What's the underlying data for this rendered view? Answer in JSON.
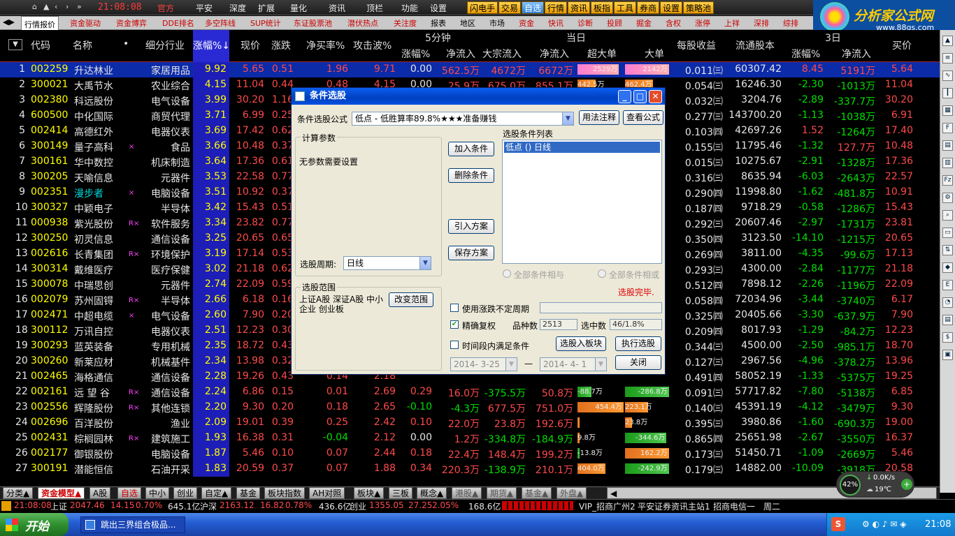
{
  "menubar": {
    "nav_icons": [
      "⌂",
      "▲",
      "‹",
      "›",
      "»"
    ],
    "time": "21:08:08",
    "items": [
      "官方",
      "平安",
      "深度",
      "扩展",
      "量化",
      "资讯",
      "顶栏",
      "功能",
      "设置"
    ],
    "toolbar_buttons": [
      "闪电手",
      "交易",
      "自选",
      "行情",
      "资讯",
      "板指",
      "工具",
      "券商",
      "设置",
      "策略池"
    ]
  },
  "logo": {
    "title": "分析家公式网",
    "url_text": "www.88gs.com"
  },
  "tabbar": {
    "tabs": [
      "行情报价",
      "资金驱动",
      "资金博弈",
      "DDE排名",
      "多空阵线",
      "SUP统计",
      "东证股票池",
      "潜伏热点",
      "关注度",
      "报表",
      "地区",
      "市场",
      "资金",
      "快讯",
      "诊断",
      "投顾",
      "掘金",
      "含权",
      "涨停",
      "上祥",
      "深排",
      "综排"
    ]
  },
  "table": {
    "headers": {
      "code": "代码",
      "name": "名称",
      "industry": "细分行业",
      "pct": "涨幅%↓",
      "price": "现价",
      "change": "涨跌",
      "net_buy_rate": "净买率%",
      "attack_wave": "攻击波%",
      "min5_group": "5分钟",
      "min5_pct": "涨幅%",
      "min5_netflow": "净流入",
      "today_group": "当日",
      "block_flow": "大宗流入",
      "today_netflow": "净流入",
      "super_large": "超大单",
      "large": "大单",
      "eps": "每股收益",
      "float_shares": "流通股本",
      "d3_group": "3日",
      "d3_pct": "涨幅%",
      "d3_netflow": "净流入",
      "bid": "买价"
    },
    "rows": [
      {
        "n": "1",
        "code": "002259",
        "name": "升达林业",
        "mark": "",
        "industry": "家居用品",
        "pct": "9.92",
        "price": "5.65",
        "chg": "0.51",
        "nb": "1.96",
        "aw": "9.71",
        "m5p": "0.00",
        "m5f": "562.5万",
        "blk": "4672万",
        "tf": "6672万",
        "sup": "2529万",
        "sup_w": 0.9,
        "lrg": "2142万",
        "lrg_w": 0.95,
        "eps": "0.011㈢",
        "fs": "60307.42",
        "d3p": "8.45",
        "d3f": "5191万",
        "bid": "5.64"
      },
      {
        "n": "2",
        "code": "300021",
        "name": "大禹节水",
        "mark": "",
        "industry": "农业综合",
        "pct": "4.15",
        "price": "11.04",
        "chg": "0.44",
        "nb": "0.48",
        "aw": "4.15",
        "m5p": "0.00",
        "m5f": "25.9万",
        "blk": "675.0万",
        "tf": "855.1万",
        "sup": "442.5万",
        "sup_w": 0.4,
        "lrg": "462.4万",
        "lrg_w": 0.6,
        "eps": "0.054㈢",
        "fs": "16246.30",
        "d3p": "-2.30",
        "d3f": "-1013万",
        "bid": "11.04"
      },
      {
        "n": "3",
        "code": "002380",
        "name": "科远股份",
        "mark": "",
        "industry": "电气设备",
        "pct": "3.99",
        "price": "30.20",
        "chg": "1.16",
        "nb": "",
        "aw": "",
        "m5p": "",
        "m5f": "",
        "blk": "",
        "tf": "",
        "sup": "",
        "sup_w": 0,
        "lrg": "",
        "lrg_w": 0.2,
        "eps": "0.032㈢",
        "fs": "3204.76",
        "d3p": "-2.89",
        "d3f": "-337.7万",
        "bid": "30.20"
      },
      {
        "n": "4",
        "code": "600500",
        "name": "中化国际",
        "mark": "",
        "industry": "商贸代理",
        "pct": "3.71",
        "price": "6.99",
        "chg": "0.25",
        "nb": "",
        "aw": "",
        "m5p": "",
        "m5f": "",
        "blk": "",
        "tf": "",
        "sup": "",
        "sup_w": 0,
        "lrg": "",
        "lrg_w": 0.1,
        "eps": "0.277㈢",
        "fs": "143700.20",
        "d3p": "-1.13",
        "d3f": "-1038万",
        "bid": "6.91"
      },
      {
        "n": "5",
        "code": "002414",
        "name": "高德红外",
        "mark": "",
        "industry": "电器仪表",
        "pct": "3.69",
        "price": "17.42",
        "chg": "0.62",
        "nb": "",
        "aw": "",
        "m5p": "",
        "m5f": "",
        "blk": "",
        "tf": "",
        "sup": "",
        "sup_w": 0,
        "lrg": "",
        "lrg_w": 0.1,
        "eps": "0.103㈣",
        "fs": "42697.26",
        "d3p": "1.52",
        "d3f": "-1264万",
        "bid": "17.40"
      },
      {
        "n": "6",
        "code": "300149",
        "name": "量子高科",
        "mark": "×",
        "industry": "食品",
        "pct": "3.66",
        "price": "10.48",
        "chg": "0.37",
        "nb": "",
        "aw": "",
        "m5p": "",
        "m5f": "",
        "blk": "",
        "tf": "",
        "sup": "",
        "sup_w": 0,
        "lrg": "",
        "lrg_w": 0.1,
        "eps": "0.155㈢",
        "fs": "11795.46",
        "d3p": "-1.32",
        "d3f": "127.7万",
        "bid": "10.48"
      },
      {
        "n": "7",
        "code": "300161",
        "name": "华中数控",
        "mark": "",
        "industry": "机床制造",
        "pct": "3.64",
        "price": "17.36",
        "chg": "0.61",
        "nb": "",
        "aw": "",
        "m5p": "",
        "m5f": "",
        "blk": "",
        "tf": "",
        "sup": "",
        "sup_w": 0,
        "lrg": "",
        "lrg_w": 0.1,
        "eps": "0.015㈢",
        "fs": "10275.67",
        "d3p": "-2.91",
        "d3f": "-1328万",
        "bid": "17.36"
      },
      {
        "n": "8",
        "code": "300205",
        "name": "天喻信息",
        "mark": "",
        "industry": "元器件",
        "pct": "3.53",
        "price": "22.58",
        "chg": "0.77",
        "nb": "",
        "aw": "",
        "m5p": "",
        "m5f": "",
        "blk": "",
        "tf": "",
        "sup": "",
        "sup_w": 0,
        "lrg": "",
        "lrg_w": 0.1,
        "eps": "0.316㈢",
        "fs": "8635.94",
        "d3p": "-6.03",
        "d3f": "-2643万",
        "bid": "22.57"
      },
      {
        "n": "9",
        "code": "002351",
        "name": "漫步者",
        "mark": "×",
        "industry": "电脑设备",
        "pct": "3.51",
        "price": "10.92",
        "chg": "0.37",
        "nb": "",
        "aw": "",
        "m5p": "",
        "m5f": "",
        "blk": "",
        "tf": "",
        "sup": "",
        "sup_w": 0,
        "lrg": "",
        "lrg_w": 0.1,
        "eps": "0.290㈣",
        "fs": "11998.80",
        "d3p": "-1.62",
        "d3f": "-481.8万",
        "bid": "10.91"
      },
      {
        "n": "10",
        "code": "300327",
        "name": "中颖电子",
        "mark": "",
        "industry": "半导体",
        "pct": "3.42",
        "price": "15.43",
        "chg": "0.51",
        "nb": "",
        "aw": "",
        "m5p": "",
        "m5f": "",
        "blk": "",
        "tf": "",
        "sup": "",
        "sup_w": 0,
        "lrg": "",
        "lrg_w": 0.1,
        "eps": "0.187㈣",
        "fs": "9718.29",
        "d3p": "-0.58",
        "d3f": "-1286万",
        "bid": "15.43"
      },
      {
        "n": "11",
        "code": "000938",
        "name": "紫光股份",
        "mark": "R×",
        "industry": "软件服务",
        "pct": "3.34",
        "price": "23.82",
        "chg": "0.77",
        "nb": "",
        "aw": "",
        "m5p": "",
        "m5f": "",
        "blk": "",
        "tf": "",
        "sup": "",
        "sup_w": 0,
        "lrg": "",
        "lrg_w": 0.1,
        "eps": "0.292㈢",
        "fs": "20607.46",
        "d3p": "-2.97",
        "d3f": "-1731万",
        "bid": "23.81"
      },
      {
        "n": "12",
        "code": "300250",
        "name": "初灵信息",
        "mark": "",
        "industry": "通信设备",
        "pct": "3.25",
        "price": "20.65",
        "chg": "0.65",
        "nb": "",
        "aw": "",
        "m5p": "",
        "m5f": "",
        "blk": "",
        "tf": "",
        "sup": "",
        "sup_w": 0,
        "lrg": "",
        "lrg_w": 0.1,
        "eps": "0.350㈣",
        "fs": "3123.50",
        "d3p": "-14.10",
        "d3f": "-1215万",
        "bid": "20.65"
      },
      {
        "n": "13",
        "code": "002616",
        "name": "长青集团",
        "mark": "R×",
        "industry": "环境保护",
        "pct": "3.19",
        "price": "17.14",
        "chg": "0.53",
        "nb": "",
        "aw": "",
        "m5p": "",
        "m5f": "",
        "blk": "",
        "tf": "",
        "sup": "",
        "sup_w": 0,
        "lrg": "",
        "lrg_w": 0.1,
        "eps": "0.269㈣",
        "fs": "3811.00",
        "d3p": "-4.35",
        "d3f": "-99.6万",
        "bid": "17.13"
      },
      {
        "n": "14",
        "code": "300314",
        "name": "戴维医疗",
        "mark": "",
        "industry": "医疗保健",
        "pct": "3.02",
        "price": "21.18",
        "chg": "0.62",
        "nb": "",
        "aw": "",
        "m5p": "",
        "m5f": "",
        "blk": "",
        "tf": "",
        "sup": "",
        "sup_w": 0,
        "lrg": "",
        "lrg_w": 0.1,
        "eps": "0.293㈢",
        "fs": "4300.00",
        "d3p": "-2.84",
        "d3f": "-1177万",
        "bid": "21.18"
      },
      {
        "n": "15",
        "code": "300078",
        "name": "中瑞思创",
        "mark": "",
        "industry": "元器件",
        "pct": "2.74",
        "price": "22.09",
        "chg": "0.59",
        "nb": "",
        "aw": "",
        "m5p": "",
        "m5f": "",
        "blk": "",
        "tf": "",
        "sup": "",
        "sup_w": 0,
        "lrg": "",
        "lrg_w": 0.1,
        "eps": "0.512㈣",
        "fs": "7898.12",
        "d3p": "-2.26",
        "d3f": "-1196万",
        "bid": "22.09"
      },
      {
        "n": "16",
        "code": "002079",
        "name": "苏州固锝",
        "mark": "R×",
        "industry": "半导体",
        "pct": "2.66",
        "price": "6.18",
        "chg": "0.16",
        "nb": "",
        "aw": "",
        "m5p": "",
        "m5f": "",
        "blk": "",
        "tf": "",
        "sup": "",
        "sup_w": 0,
        "lrg": "",
        "lrg_w": 0.1,
        "eps": "0.058㈣",
        "fs": "72034.96",
        "d3p": "-3.44",
        "d3f": "-3740万",
        "bid": "6.17"
      },
      {
        "n": "17",
        "code": "002471",
        "name": "中超电缆",
        "mark": "×",
        "industry": "电气设备",
        "pct": "2.60",
        "price": "7.90",
        "chg": "0.20",
        "nb": "",
        "aw": "",
        "m5p": "",
        "m5f": "",
        "blk": "",
        "tf": "",
        "sup": "",
        "sup_w": 0,
        "lrg": "",
        "lrg_w": 0.1,
        "eps": "0.325㈣",
        "fs": "20405.66",
        "d3p": "-3.30",
        "d3f": "-637.9万",
        "bid": "7.90"
      },
      {
        "n": "18",
        "code": "300112",
        "name": "万讯自控",
        "mark": "",
        "industry": "电器仪表",
        "pct": "2.51",
        "price": "12.23",
        "chg": "0.30",
        "nb": "",
        "aw": "",
        "m5p": "",
        "m5f": "",
        "blk": "",
        "tf": "",
        "sup": "",
        "sup_w": 0,
        "lrg": "",
        "lrg_w": 0.1,
        "eps": "0.209㈣",
        "fs": "8017.93",
        "d3p": "-1.29",
        "d3f": "-84.2万",
        "bid": "12.23"
      },
      {
        "n": "19",
        "code": "300293",
        "name": "蓝英装备",
        "mark": "",
        "industry": "专用机械",
        "pct": "2.35",
        "price": "18.72",
        "chg": "0.43",
        "nb": "",
        "aw": "",
        "m5p": "",
        "m5f": "",
        "blk": "",
        "tf": "",
        "sup": "",
        "sup_w": 0,
        "lrg": "",
        "lrg_w": 0.1,
        "eps": "0.344㈢",
        "fs": "4500.00",
        "d3p": "-2.50",
        "d3f": "-985.1万",
        "bid": "18.70"
      },
      {
        "n": "20",
        "code": "300260",
        "name": "新莱应材",
        "mark": "",
        "industry": "机械基件",
        "pct": "2.34",
        "price": "13.98",
        "chg": "0.32",
        "nb": "",
        "aw": "",
        "m5p": "",
        "m5f": "",
        "blk": "",
        "tf": "",
        "sup": "",
        "sup_w": 0,
        "lrg": "",
        "lrg_w": 0.1,
        "eps": "0.127㈢",
        "fs": "2967.56",
        "d3p": "-4.96",
        "d3f": "-378.2万",
        "bid": "13.96"
      },
      {
        "n": "21",
        "code": "002465",
        "name": "海格通信",
        "mark": "",
        "industry": "通信设备",
        "pct": "2.28",
        "price": "19.26",
        "chg": "0.43",
        "nb": "0.14",
        "aw": "2.18",
        "m5p": "",
        "m5f": "",
        "blk": "",
        "tf": "",
        "sup": "",
        "sup_w": 0,
        "lrg": "",
        "lrg_w": 0,
        "eps": "0.491㈣",
        "fs": "58052.19",
        "d3p": "-1.33",
        "d3f": "-5375万",
        "bid": "19.25"
      },
      {
        "n": "22",
        "code": "002161",
        "name": "远 望 谷",
        "mark": "R×",
        "industry": "通信设备",
        "pct": "2.24",
        "price": "6.86",
        "chg": "0.15",
        "nb": "0.01",
        "aw": "2.69",
        "m5p": "0.29",
        "m5f": "16.0万",
        "blk": "-375.5万",
        "tf": "50.8万",
        "sup": "-88.7万",
        "sup_w": -0.3,
        "lrg": "-286.8万",
        "lrg_w": -0.95,
        "eps": "0.091㈢",
        "fs": "57717.82",
        "d3p": "-7.80",
        "d3f": "-5138万",
        "bid": "6.85"
      },
      {
        "n": "23",
        "code": "002556",
        "name": "辉隆股份",
        "mark": "R×",
        "industry": "其他连锁",
        "pct": "2.20",
        "price": "9.30",
        "chg": "0.20",
        "nb": "0.18",
        "aw": "2.65",
        "m5p": "-0.10",
        "m5f": "-4.3万",
        "blk": "677.5万",
        "tf": "751.0万",
        "sup": "454.4万",
        "sup_w": 1.0,
        "lrg": "223.1万",
        "lrg_w": 0.5,
        "eps": "0.140㈢",
        "fs": "45391.19",
        "d3p": "-4.12",
        "d3f": "-3479万",
        "bid": "9.30"
      },
      {
        "n": "24",
        "code": "002696",
        "name": "百洋股份",
        "mark": "",
        "industry": "渔业",
        "pct": "2.09",
        "price": "19.01",
        "chg": "0.39",
        "nb": "0.25",
        "aw": "2.42",
        "m5p": "0.10",
        "m5f": "22.0万",
        "blk": "23.8万",
        "tf": "192.6万",
        "sup": "",
        "sup_w": 0.03,
        "lrg": "23.8万",
        "lrg_w": 0.15,
        "eps": "0.395㈢",
        "fs": "3980.86",
        "d3p": "-1.60",
        "d3f": "-690.3万",
        "bid": "19.00"
      },
      {
        "n": "25",
        "code": "002431",
        "name": "棕榈园林",
        "mark": "R×",
        "industry": "建筑施工",
        "pct": "1.93",
        "price": "16.38",
        "chg": "0.31",
        "nb": "-0.04",
        "aw": "2.12",
        "m5p": "0.00",
        "m5f": "1.2万",
        "blk": "-334.8万",
        "tf": "-184.9万",
        "sup": "9.8万",
        "sup_w": 0.05,
        "lrg": "-344.6万",
        "lrg_w": -0.9,
        "eps": "0.865㈣",
        "fs": "25651.98",
        "d3p": "-2.67",
        "d3f": "-3550万",
        "bid": "16.37"
      },
      {
        "n": "26",
        "code": "002177",
        "name": "御银股份",
        "mark": "",
        "industry": "电脑设备",
        "pct": "1.87",
        "price": "5.46",
        "chg": "0.10",
        "nb": "0.07",
        "aw": "2.44",
        "m5p": "0.18",
        "m5f": "22.4万",
        "blk": "148.4万",
        "tf": "199.2万",
        "sup": "-13.8万",
        "sup_w": -0.05,
        "lrg": "162.2万",
        "lrg_w": 0.95,
        "eps": "0.173㈢",
        "fs": "51450.71",
        "d3p": "-1.09",
        "d3f": "-2669万",
        "bid": "5.46"
      },
      {
        "n": "27",
        "code": "300191",
        "name": "潜能恒信",
        "mark": "",
        "industry": "石油开采",
        "pct": "1.83",
        "price": "20.59",
        "chg": "0.37",
        "nb": "0.07",
        "aw": "1.88",
        "m5p": "0.34",
        "m5f": "220.3万",
        "blk": "-138.9万",
        "tf": "210.1万",
        "sup": "404.0万",
        "sup_w": 0.6,
        "lrg": "-242.9万",
        "lrg_w": -0.95,
        "eps": "0.179㈢",
        "fs": "14882.00",
        "d3p": "-10.09",
        "d3f": "-3918万",
        "bid": "20.58"
      }
    ]
  },
  "bottom_tabs": [
    "分类▲",
    "资金模型▲",
    "A股",
    "自选",
    "中小",
    "创业",
    "自定▲",
    "基金",
    "板块指数",
    "AH对照",
    "板块▲",
    "三板",
    "概念▲",
    "港股▲",
    "期货▲",
    "基金▲",
    "外盘▲"
  ],
  "status_bar": {
    "time": "21:08:08",
    "sh_label": "上证",
    "sh_index": "2047.46",
    "sh_change": "14.15",
    "sh_pct": "0.70%",
    "sh_amount": "645.1亿",
    "sz_label": "沪深",
    "sz_index": "2163.12",
    "sz_change": "16.82",
    "sz_pct": "0.78%",
    "sz_amount": "436.6亿",
    "cy_label": "创业",
    "cy_index": "1355.05",
    "cy_change": "27.25",
    "cy_pct": "2.05%",
    "cy_amount": "168.6亿",
    "vip": "VIP_招商广州2",
    "station": "平安证券资讯主站1",
    "telecom": "招商电信一",
    "weekday": "周二"
  },
  "net_widget": {
    "cpu": "42%",
    "speed": "0.0K/s",
    "temp": "19℃"
  },
  "taskbar": {
    "start": "开始",
    "task": "跳出三界组合极品...",
    "clock": "21:08"
  },
  "dialog": {
    "title": "条件选股",
    "formula_label": "条件选股公式",
    "formula_value": "低点     - 低胜算率89.8%★★★准备赚钱",
    "usage_button": "用法注释",
    "view_formula_button": "查看公式",
    "params_group": "计算参数",
    "no_params": "无参数需要设置",
    "add_condition": "加入条件",
    "delete_condition": "删除条件",
    "import_plan": "引入方案",
    "save_plan": "保存方案",
    "conditions_label": "选股条件列表",
    "conditions": [
      "低点  ()  日线"
    ],
    "all_and": "全部条件相与",
    "all_or": "全部条件相或",
    "done_text": "选股完毕.",
    "period_label": "选股周期:",
    "period_value": "日线",
    "range_group": "选股范围",
    "range_text": "上证A股 深证A股 中小企业 创业板",
    "change_range": "改变范围",
    "use_irregular": "使用涨跌不定周期",
    "exact_rights": "精确复权",
    "variety_label": "品种数",
    "variety_value": "2513",
    "selected_label": "选中数",
    "selected_value": "46/1.8%",
    "time_range": "时间段内满足条件",
    "add_to_block": "选股入板块",
    "execute": "执行选股",
    "date_start": "2014- 3-25",
    "date_end": "2014- 4- 1",
    "date_sep": "—",
    "close": "关闭"
  }
}
